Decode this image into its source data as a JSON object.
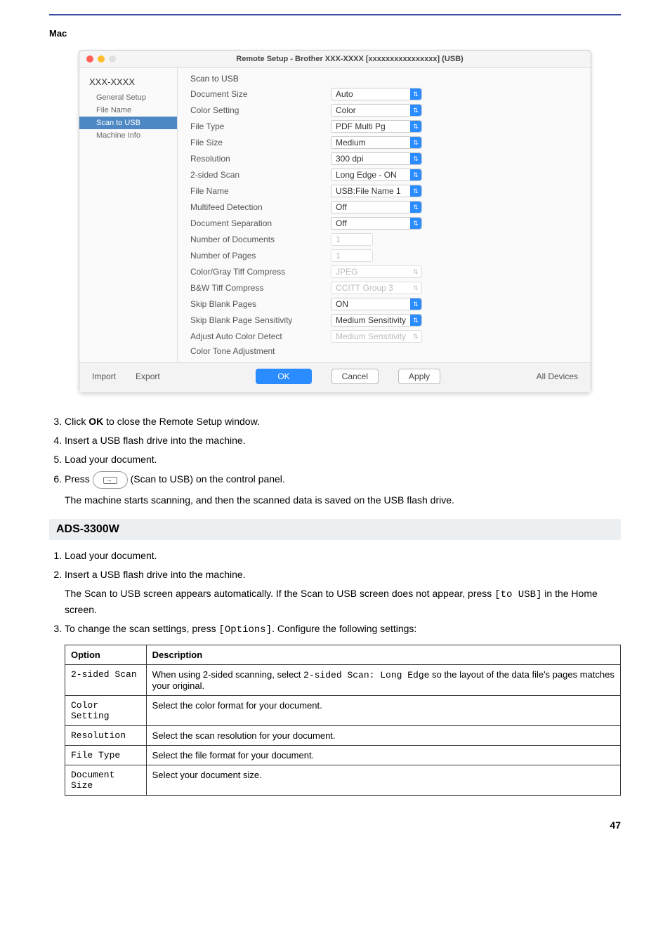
{
  "page": {
    "number": "47",
    "mac_label": "Mac"
  },
  "mac_window": {
    "title": "Remote Setup - Brother XXX-XXXX  [xxxxxxxxxxxxxxxx]  (USB)",
    "sidebar": {
      "root": "XXX-XXXX",
      "items": [
        "General Setup",
        "File Name",
        "Scan to USB",
        "Machine Info"
      ],
      "selected_index": 2
    },
    "main_title": "Scan to USB",
    "rows": [
      {
        "label": "Document Size",
        "value": "Auto",
        "enabled": true,
        "type": "select"
      },
      {
        "label": "Color Setting",
        "value": "Color",
        "enabled": true,
        "type": "select"
      },
      {
        "label": "File Type",
        "value": "PDF Multi Pg",
        "enabled": true,
        "type": "select"
      },
      {
        "label": "File Size",
        "value": "Medium",
        "enabled": true,
        "type": "select"
      },
      {
        "label": "Resolution",
        "value": "300 dpi",
        "enabled": true,
        "type": "select"
      },
      {
        "label": "2-sided Scan",
        "value": "Long Edge - ON",
        "enabled": true,
        "type": "select"
      },
      {
        "label": "File Name",
        "value": "USB:File Name 1",
        "enabled": true,
        "type": "select"
      },
      {
        "label": "Multifeed Detection",
        "value": "Off",
        "enabled": true,
        "type": "select"
      },
      {
        "label": "Document Separation",
        "value": "Off",
        "enabled": true,
        "type": "select"
      },
      {
        "label": "Number of Documents",
        "value": "1",
        "enabled": false,
        "type": "input"
      },
      {
        "label": "Number of Pages",
        "value": "1",
        "enabled": false,
        "type": "input"
      },
      {
        "label": "Color/Gray Tiff Compress",
        "value": "JPEG",
        "enabled": false,
        "type": "select"
      },
      {
        "label": "B&W Tiff Compress",
        "value": "CCITT Group 3",
        "enabled": false,
        "type": "select"
      },
      {
        "label": "Skip Blank Pages",
        "value": "ON",
        "enabled": true,
        "type": "select"
      },
      {
        "label": "Skip Blank Page Sensitivity",
        "value": "Medium Sensitivity",
        "enabled": true,
        "type": "select"
      },
      {
        "label": "Adjust Auto Color Detect",
        "value": "Medium Sensitivity",
        "enabled": false,
        "type": "select"
      },
      {
        "label": "Color Tone Adjustment",
        "value": "",
        "enabled": true,
        "type": "label"
      }
    ],
    "footer": {
      "import": "Import",
      "export": "Export",
      "ok": "OK",
      "cancel": "Cancel",
      "apply": "Apply",
      "all_devices": "All Devices"
    }
  },
  "steps_a": {
    "start": "3",
    "items": [
      {
        "pre": "Click ",
        "bold": "OK",
        "post": " to close the Remote Setup window."
      },
      {
        "text": "Insert a USB flash drive into the machine."
      },
      {
        "text": "Load your document."
      },
      {
        "pre": "Press ",
        "post": " (Scan to USB) on the control panel.",
        "sub": "The machine starts scanning, and then the scanned data is saved on the USB flash drive."
      }
    ]
  },
  "model_header": "ADS-3300W",
  "steps_b": {
    "items": [
      {
        "text": "Load your document."
      },
      {
        "text": "Insert a USB flash drive into the machine.",
        "sub_pre": "The Scan to USB screen appears automatically. If the Scan to USB screen does not appear, press ",
        "sub_code": "[to USB]",
        "sub_post": " in the Home screen."
      },
      {
        "pre": "To change the scan settings, press ",
        "code": "[Options]",
        "post": ". Configure the following settings:"
      }
    ]
  },
  "options_table": {
    "headers": [
      "Option",
      "Description"
    ],
    "rows": [
      {
        "opt": "2-sided Scan",
        "desc_pre": "When using 2-sided scanning, select ",
        "desc_code": "2-sided Scan: Long Edge",
        "desc_post": " so the layout of the data file's pages matches your original."
      },
      {
        "opt": "Color Setting",
        "desc": "Select the color format for your document."
      },
      {
        "opt": "Resolution",
        "desc": "Select the scan resolution for your document."
      },
      {
        "opt": "File Type",
        "desc": "Select the file format for your document."
      },
      {
        "opt": "Document Size",
        "desc": "Select your document size."
      }
    ]
  }
}
